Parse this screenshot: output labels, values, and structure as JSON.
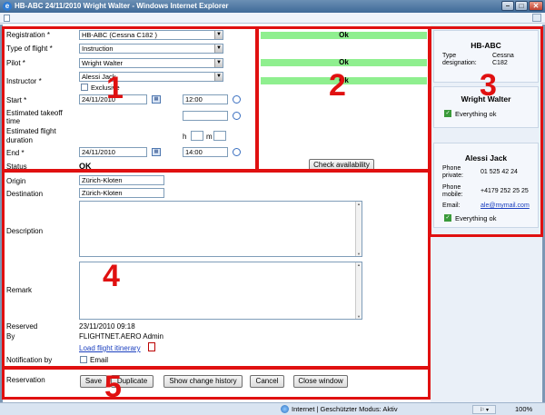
{
  "window": {
    "title": "HB-ABC 24/11/2010 Wright Walter - Windows Internet Explorer",
    "logo": "e",
    "min_label": "–",
    "max_label": "□",
    "close_label": "✕"
  },
  "form": {
    "registration_label": "Registration *",
    "registration_value": "HB-ABC (Cessna C182 )",
    "type_label": "Type of flight *",
    "type_value": "Instruction",
    "pilot_label": "Pilot *",
    "pilot_value": "Wright Walter",
    "instructor_label": "Instructor *",
    "instructor_value": "Alessi Jack",
    "exclusive_label": "Exclusive",
    "start_label": "Start *",
    "start_date": "24/11/2010",
    "start_time": "12:00",
    "takeoff_label_1": "Estimated takeoff",
    "takeoff_label_2": "time",
    "duration_label_1": "Estimated flight",
    "duration_label_2": "duration",
    "hours_unit": "h",
    "minutes_unit": "m",
    "end_label": "End *",
    "end_date": "24/11/2010",
    "end_time": "14:00",
    "status_label": "Status",
    "status_value": "OK",
    "origin_label": "Origin",
    "origin_value": "Zürich-Kloten",
    "destination_label": "Destination",
    "destination_value": "Zürich-Kloten",
    "description_label": "Description",
    "remark_label": "Remark",
    "reserved_label": "Reserved",
    "reserved_value": "23/11/2010 09:18",
    "by_label": "By",
    "by_value": "FLIGHTNET.AERO Admin",
    "itinerary_link": "Load flight itinerary",
    "notification_label": "Notification by",
    "email_label": "Email",
    "reservation_label": "Reservation"
  },
  "availability": {
    "rows": [
      "Ok",
      "Ok",
      "Ok"
    ],
    "check_button": "Check availability"
  },
  "buttons": {
    "save": "Save",
    "duplicate": "Duplicate",
    "history": "Show change history",
    "cancel": "Cancel",
    "close": "Close window"
  },
  "aircraft_card": {
    "title": "HB-ABC",
    "type_label_1": "Type",
    "type_label_2": "designation:",
    "type_value": "Cessna",
    "type_value_2": "C182"
  },
  "pilot_card": {
    "title": "Wright Walter",
    "status": "Everything ok"
  },
  "instructor_card": {
    "title": "Alessi Jack",
    "phone_private_label_1": "Phone",
    "phone_private_label_2": "private:",
    "phone_private_value": "01 525 42 24",
    "phone_mobile_label_1": "Phone",
    "phone_mobile_label_2": "mobile:",
    "phone_mobile_value": "+4179 252 25 25",
    "email_label": "Email:",
    "email_value": "ale@mymail.com",
    "status": "Everything ok"
  },
  "annotations": [
    "1",
    "2",
    "3",
    "4",
    "5"
  ],
  "statusbar": {
    "zone": "Internet | Geschützter Modus: Aktiv",
    "zoom": "100%"
  },
  "colors": {
    "highlight_red": "#e01010",
    "ok_green": "#8fef8f",
    "panel_blue": "#eaf0f8"
  }
}
